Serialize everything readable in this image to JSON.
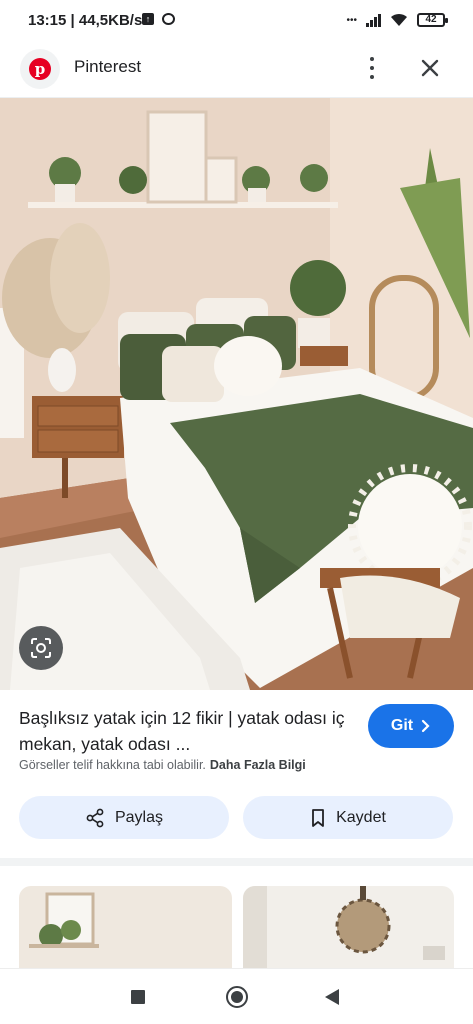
{
  "status_bar": {
    "time": "13:15",
    "speed": "| 44,5KB/s",
    "battery": "42"
  },
  "header": {
    "app_name": "Pinterest",
    "icons": [
      "pinterest-logo-icon",
      "more-vert-icon",
      "close-icon"
    ]
  },
  "pin": {
    "title": "Başlıksız yatak için 12 fikir | yatak odası iç mekan, yatak odası ...",
    "go_label": "Git",
    "copyright_notice": "Görseller telif hakkına tabi olabilir.",
    "more_info_label": "Daha Fazla Bilgi",
    "share_label": "Paylaş",
    "save_label": "Kaydet"
  },
  "colors": {
    "accent": "#1a73e8",
    "button_bg": "#e8f0fe",
    "brand": "#e60023"
  }
}
